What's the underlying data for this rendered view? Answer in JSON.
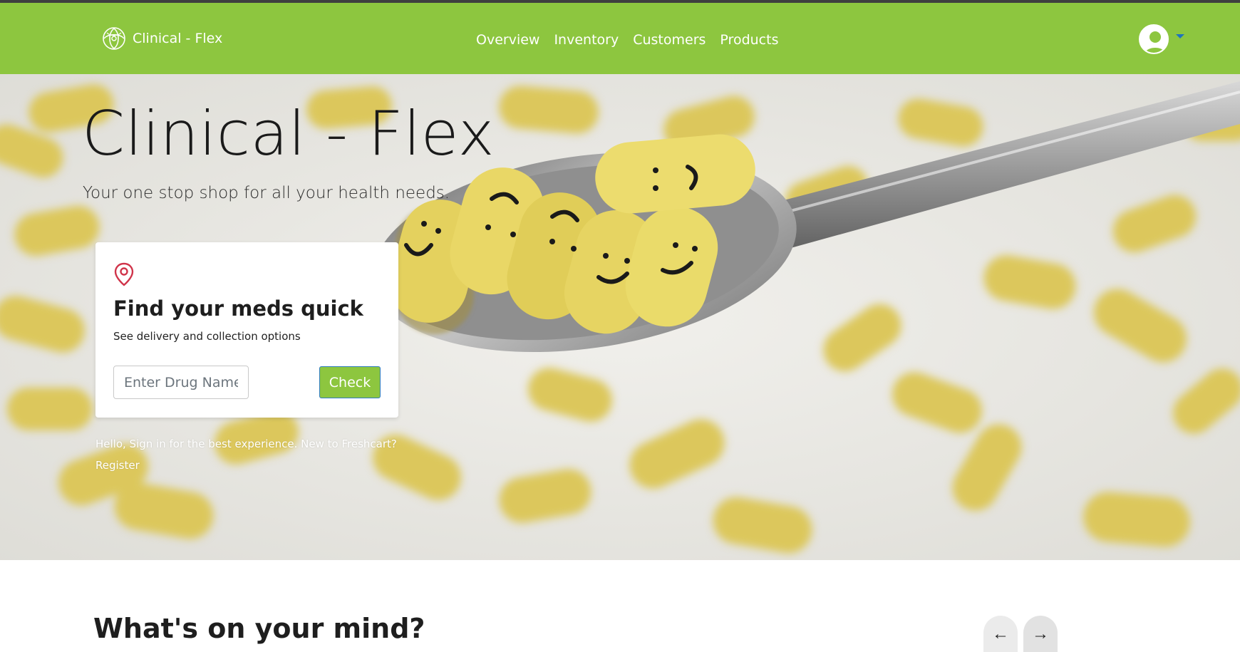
{
  "app": {
    "brand": "Clinical - Flex",
    "brand_color": "#8dc63f",
    "accent_color": "#1e73be"
  },
  "nav": {
    "links": [
      {
        "label": "Overview"
      },
      {
        "label": "Inventory"
      },
      {
        "label": "Customers"
      },
      {
        "label": "Products"
      }
    ],
    "avatar_icon": "user-avatar-icon",
    "dropdown_icon": "caret-down-icon"
  },
  "hero": {
    "title": "Clinical - Flex",
    "subtitle": "Your one stop shop for all your health needs.",
    "background": "pills-on-spoon-photo"
  },
  "search_card": {
    "icon": "location-pin-icon",
    "title": "Find your meds quick",
    "description": "See delivery and collection options",
    "input_placeholder": "Enter Drug Name",
    "button_label": "Check"
  },
  "signin": {
    "line1": "Hello, Sign in for the best experience. New to Freshcart?",
    "line2": "Register"
  },
  "section": {
    "title": "What's on your mind?",
    "prev_icon": "arrow-left-icon",
    "next_icon": "arrow-right-icon"
  }
}
